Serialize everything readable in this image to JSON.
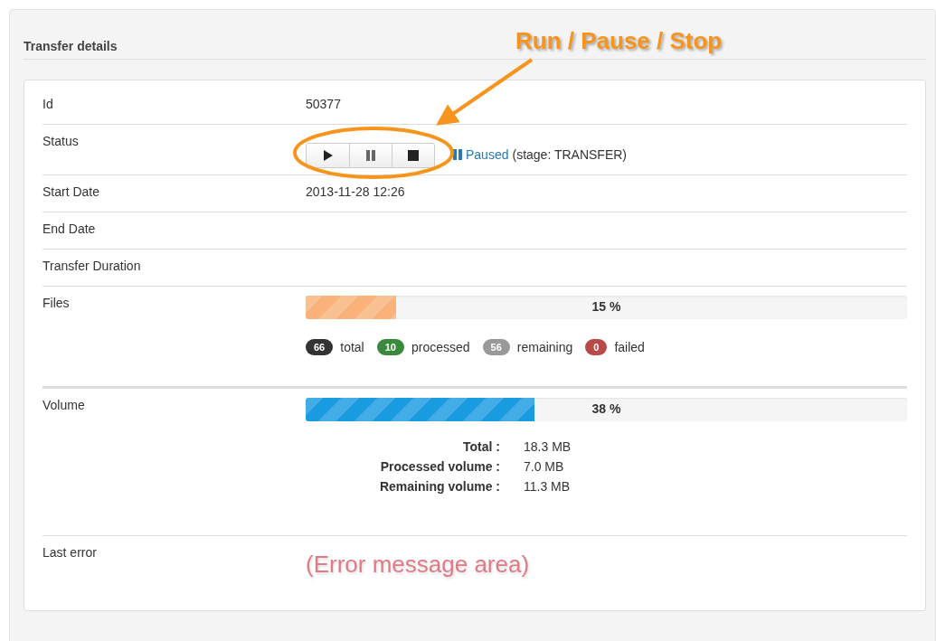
{
  "panel": {
    "title": "Transfer details"
  },
  "annotation": {
    "text": "Run / Pause / Stop"
  },
  "rows": [
    {
      "kind": "text",
      "label": "Id",
      "value": "50377"
    },
    {
      "kind": "status",
      "label": "Status",
      "controls": [
        {
          "kind": "play"
        },
        {
          "kind": "pause"
        },
        {
          "kind": "stop"
        }
      ],
      "state": "Paused",
      "detail": "(stage: TRANSFER)"
    },
    {
      "kind": "text",
      "label": "Start Date",
      "value": "2013-11-28 12:26"
    },
    {
      "kind": "text",
      "label": "End Date"
    },
    {
      "kind": "text",
      "label": "Transfer Duration"
    },
    {
      "kind": "files",
      "label": "Files",
      "level": 0.15,
      "reading": "15 %",
      "color": "#f8b27a",
      "counts": [
        {
          "count": "66",
          "label": "total",
          "color": "#333333"
        },
        {
          "count": "10",
          "label": "processed",
          "color": "#3a8a3e"
        },
        {
          "count": "56",
          "label": "remaining",
          "color": "#999999"
        },
        {
          "count": "0",
          "label": "failed",
          "color": "#b94a48"
        }
      ]
    },
    {
      "kind": "volume",
      "label": "Volume",
      "level": 0.38,
      "reading": "38 %",
      "color": "#1a9ae0",
      "stats": [
        {
          "name": "Total :",
          "value": "18.3 MB"
        },
        {
          "name": "Processed volume :",
          "value": "7.0 MB"
        },
        {
          "name": "Remaining volume :",
          "value": "11.3 MB"
        }
      ]
    },
    {
      "kind": "error",
      "label": "Last error",
      "message": "(Error message area)"
    }
  ]
}
